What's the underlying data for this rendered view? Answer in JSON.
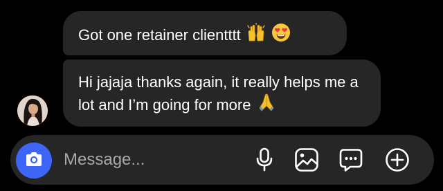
{
  "messages": [
    {
      "text": "Got one retainer clientttt",
      "emojis": [
        "raising-hands-icon",
        "heart-eyes-icon"
      ]
    },
    {
      "text": "Hi jajaja thanks again, it really helps me a lot and I’m going for more",
      "emojis": [
        "folded-hands-icon"
      ]
    }
  ],
  "composer": {
    "placeholder": "Message...",
    "value": "",
    "camera_icon": "camera-icon",
    "tools": [
      "microphone-icon",
      "image-icon",
      "sticker-icon",
      "plus-circle-icon"
    ]
  },
  "colors": {
    "background": "#000000",
    "bubble": "#262626",
    "accent": "#3e66f6",
    "placeholder": "#a8a8a8",
    "emoji_yellow": "#f5c02b"
  }
}
